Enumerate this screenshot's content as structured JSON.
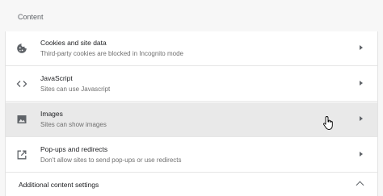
{
  "section": {
    "title": "Content"
  },
  "rows": [
    {
      "title": "Cookies and site data",
      "subtitle": "Third-party cookies are blocked in Incognito mode",
      "icon": "cookie-icon"
    },
    {
      "title": "JavaScript",
      "subtitle": "Sites can use Javascript",
      "icon": "code-icon"
    },
    {
      "title": "Images",
      "subtitle": "Sites can show images",
      "icon": "image-icon"
    },
    {
      "title": "Pop-ups and redirects",
      "subtitle": "Don't allow sites to send pop-ups or use redirects",
      "icon": "open-in-new-icon"
    }
  ],
  "additional": {
    "title": "Additional content settings"
  },
  "colors": {
    "hover": "#e9e9e9",
    "icon": "#5f6368"
  }
}
